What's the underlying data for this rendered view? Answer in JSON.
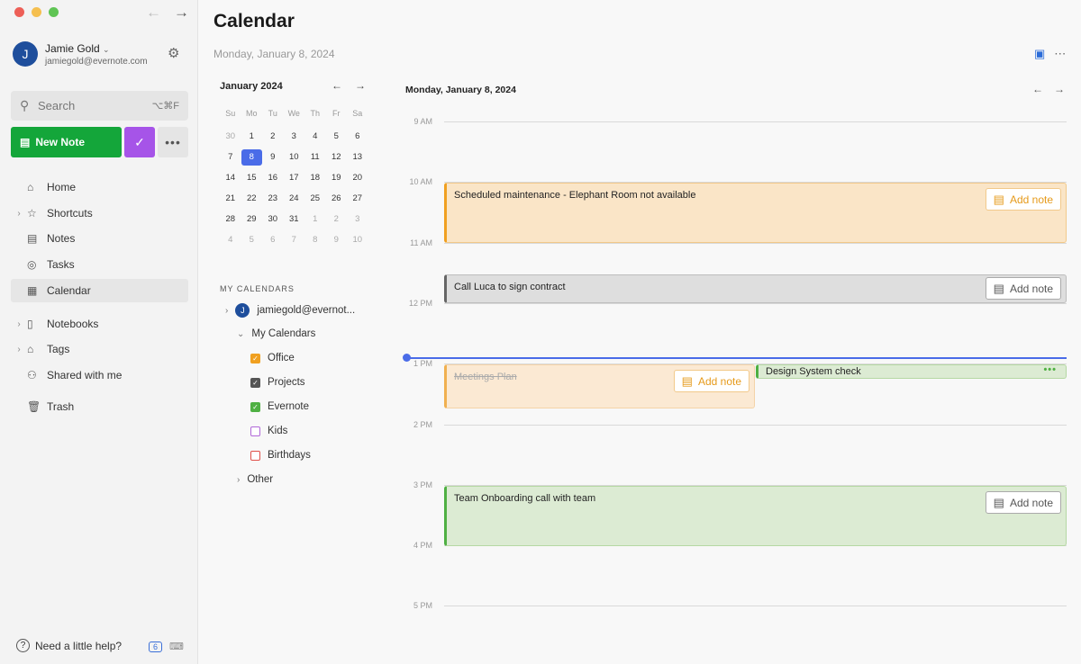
{
  "window": {
    "close_color": "#ed5f57",
    "min_color": "#f5bf4f",
    "max_color": "#5fc454"
  },
  "account": {
    "initial": "J",
    "name": "Jamie Gold",
    "email": "jamiegold@evernote.com"
  },
  "search": {
    "placeholder": "Search",
    "shortcut": "⌥⌘F"
  },
  "toolbar": {
    "new_note_label": "New Note"
  },
  "nav": {
    "home": "Home",
    "shortcuts": "Shortcuts",
    "notes": "Notes",
    "tasks": "Tasks",
    "calendar": "Calendar",
    "notebooks": "Notebooks",
    "tags": "Tags",
    "shared": "Shared with me",
    "trash": "Trash"
  },
  "help": {
    "label": "Need a little help?",
    "badge": "6"
  },
  "page": {
    "title": "Calendar",
    "date": "Monday, January 8, 2024"
  },
  "mini_calendar": {
    "month": "January 2024",
    "dows": [
      "Su",
      "Mo",
      "Tu",
      "We",
      "Th",
      "Fr",
      "Sa"
    ],
    "days": [
      [
        "30",
        "muted"
      ],
      [
        "1",
        ""
      ],
      [
        "2",
        ""
      ],
      [
        "3",
        ""
      ],
      [
        "4",
        ""
      ],
      [
        "5",
        ""
      ],
      [
        "6",
        ""
      ],
      [
        "7",
        ""
      ],
      [
        "8",
        "sel"
      ],
      [
        "9",
        ""
      ],
      [
        "10",
        ""
      ],
      [
        "11",
        ""
      ],
      [
        "12",
        ""
      ],
      [
        "13",
        ""
      ],
      [
        "14",
        ""
      ],
      [
        "15",
        ""
      ],
      [
        "16",
        ""
      ],
      [
        "17",
        ""
      ],
      [
        "18",
        ""
      ],
      [
        "19",
        ""
      ],
      [
        "20",
        ""
      ],
      [
        "21",
        ""
      ],
      [
        "22",
        ""
      ],
      [
        "23",
        ""
      ],
      [
        "24",
        ""
      ],
      [
        "25",
        ""
      ],
      [
        "26",
        ""
      ],
      [
        "27",
        ""
      ],
      [
        "28",
        ""
      ],
      [
        "29",
        ""
      ],
      [
        "30",
        ""
      ],
      [
        "31",
        ""
      ],
      [
        "1",
        "muted"
      ],
      [
        "2",
        "muted"
      ],
      [
        "3",
        "muted"
      ],
      [
        "4",
        "muted"
      ],
      [
        "5",
        "muted"
      ],
      [
        "6",
        "muted"
      ],
      [
        "7",
        "muted"
      ],
      [
        "8",
        "muted"
      ],
      [
        "9",
        "muted"
      ],
      [
        "10",
        "muted"
      ]
    ]
  },
  "my_calendars": {
    "section_title": "MY CALENDARS",
    "account_initial": "J",
    "account": "jamiegold@evernot...",
    "group": "My Calendars",
    "items": [
      {
        "label": "Office",
        "color": "#f0a020",
        "checked": true
      },
      {
        "label": "Projects",
        "color": "#555555",
        "checked": true
      },
      {
        "label": "Evernote",
        "color": "#4fb043",
        "checked": true
      },
      {
        "label": "Kids",
        "color": "#b068d8",
        "checked": false
      },
      {
        "label": "Birthdays",
        "color": "#e0504a",
        "checked": false
      }
    ],
    "other": "Other"
  },
  "day_view": {
    "header": "Monday, January 8, 2024",
    "hours": [
      "9 AM",
      "10 AM",
      "11 AM",
      "12 PM",
      "1 PM",
      "2 PM",
      "3 PM",
      "4 PM",
      "5 PM"
    ],
    "events": {
      "maintenance": "Scheduled maintenance - Elephant Room not available",
      "luca": "Call Luca to sign contract",
      "meetings": "Meetings Plan",
      "design": "Design System check",
      "onboarding": "Team Onboarding call with team"
    },
    "add_note_label": "Add note"
  }
}
